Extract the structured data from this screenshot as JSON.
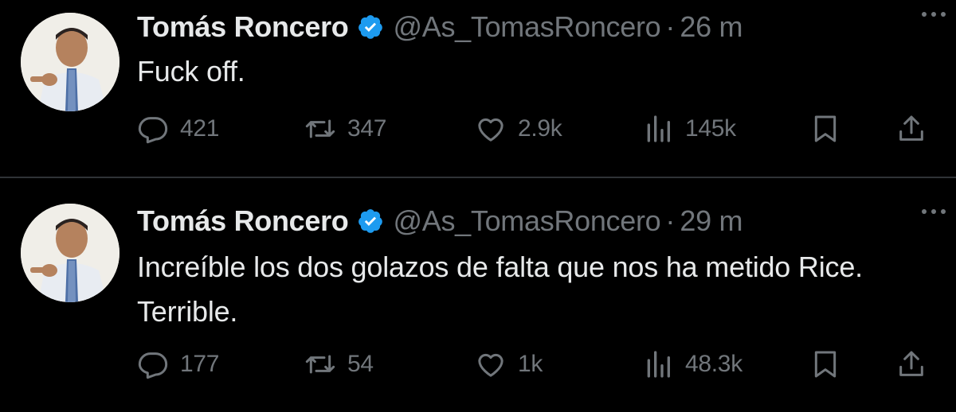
{
  "tweets": [
    {
      "author": {
        "name": "Tomás Roncero",
        "handle": "@As_TomasRoncero",
        "verified": true
      },
      "time": "26 m",
      "separator": "·",
      "text": "Fuck off.",
      "stats": {
        "replies": "421",
        "retweets": "347",
        "likes": "2.9k",
        "views": "145k"
      }
    },
    {
      "author": {
        "name": "Tomás Roncero",
        "handle": "@As_TomasRoncero",
        "verified": true
      },
      "time": "29 m",
      "separator": "·",
      "text": "Increíble los dos golazos de falta que nos ha metido Rice. Terrible.",
      "stats": {
        "replies": "177",
        "retweets": "54",
        "likes": "1k",
        "views": "48.3k"
      }
    }
  ],
  "colors": {
    "background": "#000000",
    "primary_text": "#e7e9ea",
    "secondary_text": "#71767b",
    "verified_badge": "#1d9bf0",
    "divider": "#2f3336"
  },
  "icons": [
    "verified-badge-icon",
    "more-icon",
    "reply-icon",
    "retweet-icon",
    "like-icon",
    "views-icon",
    "bookmark-icon",
    "share-icon"
  ]
}
